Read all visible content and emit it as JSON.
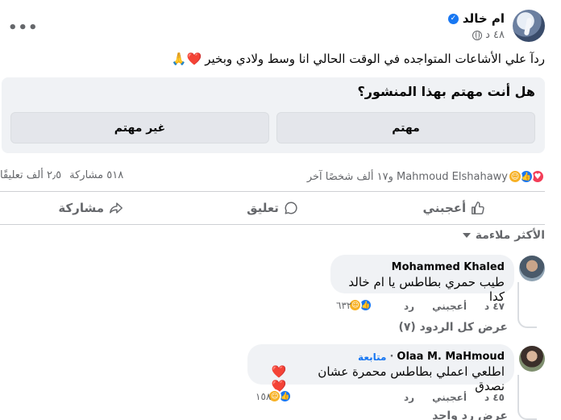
{
  "post": {
    "author_name": "ام خالد",
    "time": "٤٨ د",
    "more_label": "•••",
    "text": "ردآ علي الأشاعات المتواجده في الوقت الحالي انا وسط ولادي وبخير",
    "text_emojis": "❤️🙏"
  },
  "poll": {
    "question": "هل أنت مهتم بهذا المنشور؟",
    "option_interested": "مهتم",
    "option_not_interested": "غير مهتم"
  },
  "stats": {
    "reactions_names": "Mahmoud Elshahawy و١٧ ألف شخصًا آخر",
    "comments_count": "٢٫٥ ألف تعليقًا",
    "shares_count": "٥١٨ مشاركة"
  },
  "actions": {
    "like": "أعجبني",
    "comment": "تعليق",
    "share": "مشاركة"
  },
  "sort": {
    "label": "الأكثر ملاءمة"
  },
  "comments": [
    {
      "author": "Mohammed Khaled",
      "follow": "",
      "text": "طيب حمري بطاطس يا ام خالد كدا",
      "emojis": "",
      "time": "٤٧ د",
      "like_label": "أعجبني",
      "reply_label": "رد",
      "reaction_count": "٦٣٢",
      "view_replies": "عرض كل الردود (٧)"
    },
    {
      "author": "Olaa M. MaHmoud",
      "follow": "متابعة",
      "text": "اطلعي اعملي بطاطس محمرة عشان نصدق",
      "emojis": "❤️❤️",
      "time": "٤٥ د",
      "like_label": "أعجبني",
      "reply_label": "رد",
      "reaction_count": "١٥٨",
      "view_replies": "عرض رد واحد"
    }
  ],
  "icons": {
    "verified": "verified-badge-icon",
    "globe": "globe-icon",
    "like": "thumbs-up-icon",
    "comment": "speech-bubble-icon",
    "share": "share-arrow-icon"
  },
  "colors": {
    "accent": "#1877f2",
    "love": "#f33e58",
    "care": "#f7b125"
  }
}
